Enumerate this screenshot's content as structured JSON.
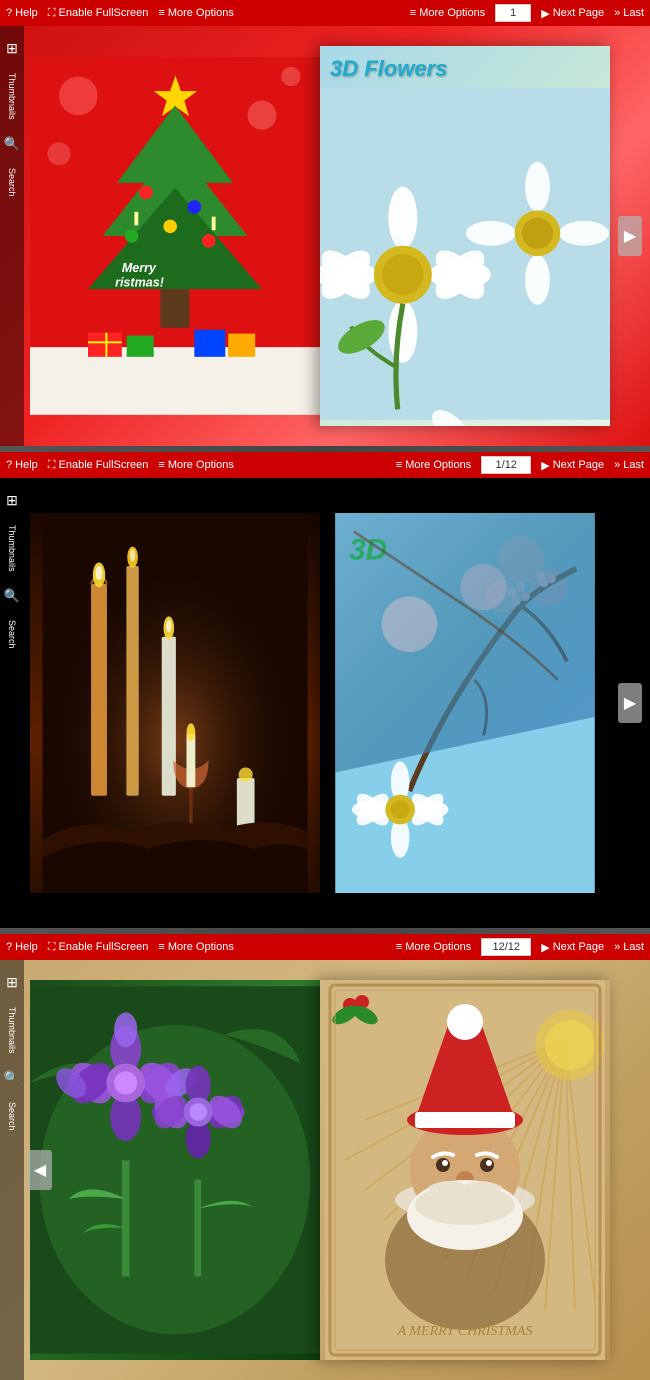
{
  "toolbar1": {
    "help": "? Help",
    "fullscreen": "Enable FullScreen",
    "more_options1": "More Options",
    "more_options2": "More Options",
    "page_value": "1",
    "next_page": "Next Page",
    "last": "Last"
  },
  "toolbar2": {
    "help": "? Help",
    "fullscreen": "Enable FullScreen",
    "more_options1": "More Options",
    "more_options2": "More Options",
    "page_value": "1/12",
    "next_page": "Next Page",
    "last": "Last"
  },
  "toolbar3": {
    "help": "? Help",
    "fullscreen": "Enable FullScreen",
    "more_options1": "More Options",
    "more_options2": "More Options",
    "page_value": "12/12",
    "next_page": "Next Page",
    "last": "Last"
  },
  "panel1": {
    "title": "3D Flowers",
    "left_content": "Christmas Tree",
    "right_content": "Daisy Flowers"
  },
  "panel2": {
    "title": "3D",
    "left_content": "Candles",
    "right_content": "Cherry Blossoms"
  },
  "panel3": {
    "title": "A MERRY CHRISTMAS",
    "left_content": "Purple Flowers",
    "right_content": "Santa Claus"
  },
  "sidebar": {
    "thumbnails": "Thumbnails",
    "search": "Search"
  },
  "colors": {
    "toolbar_bg": "#cc0000",
    "text_white": "#ffffff"
  }
}
